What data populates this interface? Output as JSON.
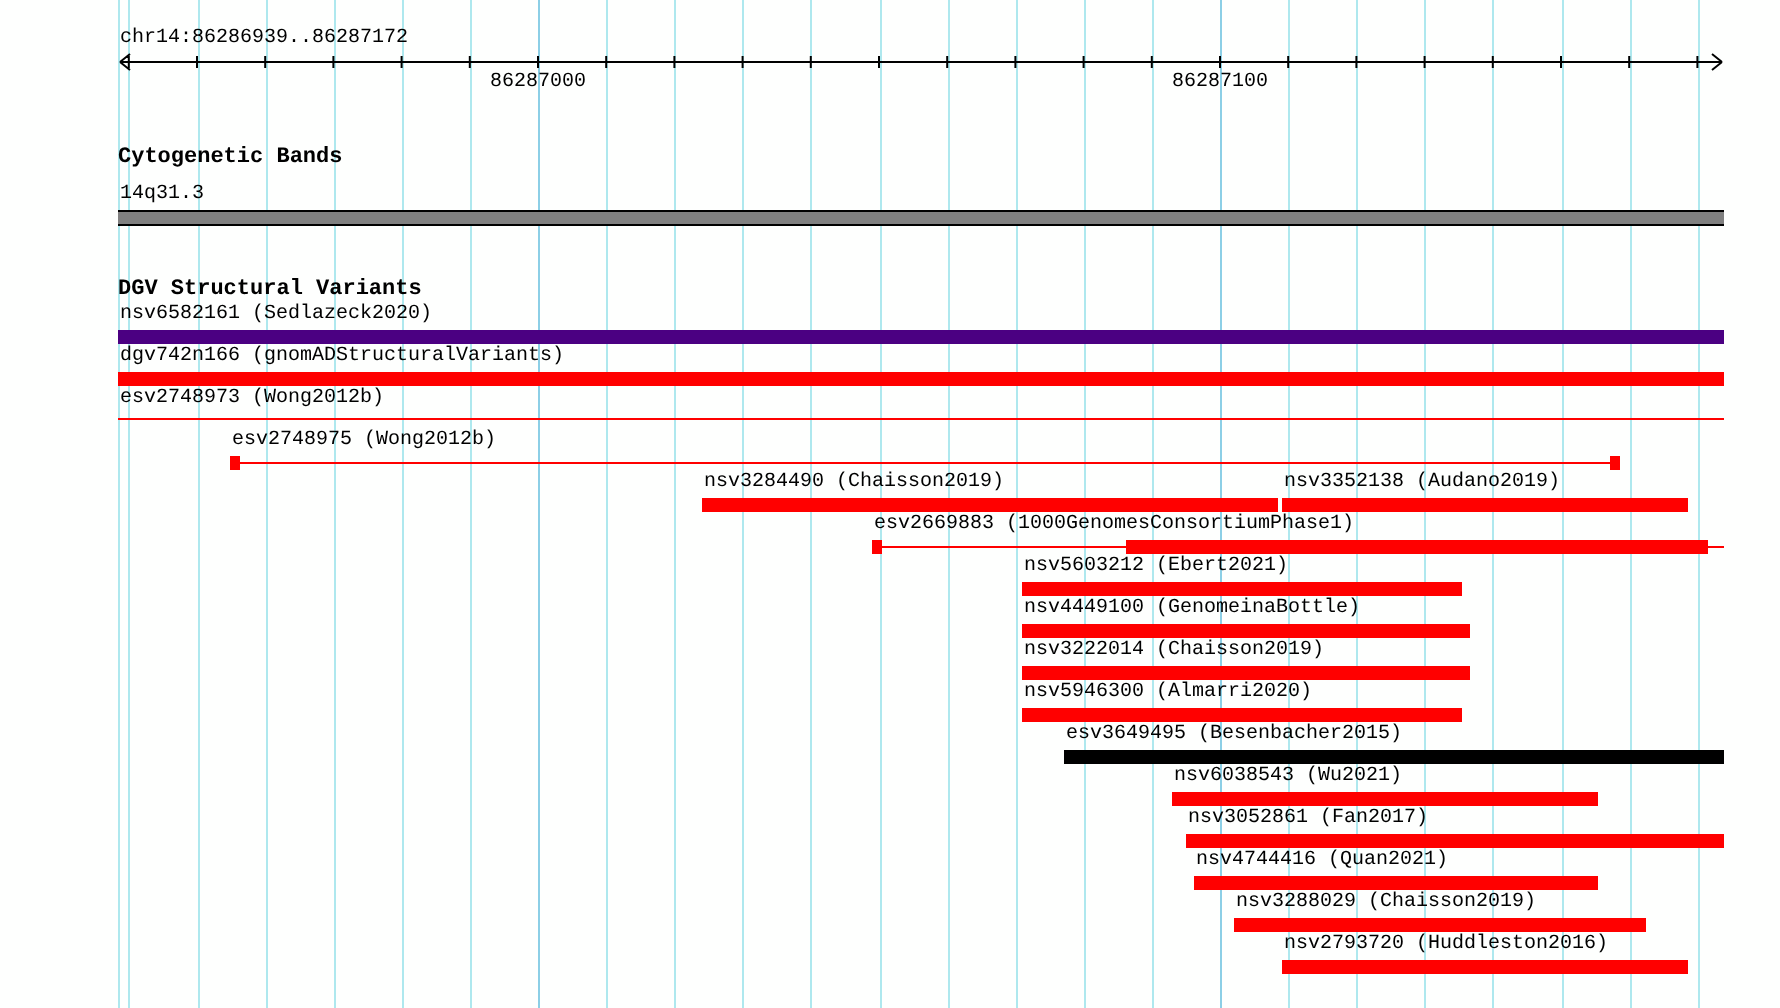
{
  "ruler": {
    "location": "chr14:86286939..86287172",
    "tick_labels": [
      "86287000",
      "86287100"
    ]
  },
  "cytogenetic_bands": {
    "title": "Cytogenetic Bands",
    "band": {
      "label": "14q31.3"
    }
  },
  "dgv_track": {
    "title": "DGV Structural Variants",
    "rows": [
      [
        {
          "label": "nsv6582161 (Sedlazeck2020)",
          "kind": "bar",
          "color": "#4b0082"
        }
      ],
      [
        {
          "label": "dgv742n166 (gnomADStructuralVariants)",
          "kind": "bar",
          "color": "#ff0000"
        }
      ],
      [
        {
          "label": "esv2748973 (Wong2012b)",
          "kind": "line",
          "color": "#ff0000"
        }
      ],
      [
        {
          "label": "esv2748975 (Wong2012b)",
          "kind": "capped_line",
          "color": "#ff0000"
        }
      ],
      [
        {
          "label": "nsv3284490 (Chaisson2019)",
          "kind": "bar",
          "color": "#ff0000"
        },
        {
          "label": "nsv3352138 (Audano2019)",
          "kind": "bar",
          "color": "#ff0000"
        }
      ],
      [
        {
          "label": "esv2669883 (1000GenomesConsortiumPhase1)",
          "kind": "line_with_block",
          "color": "#ff0000"
        }
      ],
      [
        {
          "label": "nsv5603212 (Ebert2021)",
          "kind": "bar",
          "color": "#ff0000"
        }
      ],
      [
        {
          "label": "nsv4449100 (GenomeinaBottle)",
          "kind": "bar",
          "color": "#ff0000"
        }
      ],
      [
        {
          "label": "nsv3222014 (Chaisson2019)",
          "kind": "bar",
          "color": "#ff0000"
        }
      ],
      [
        {
          "label": "nsv5946300 (Almarri2020)",
          "kind": "bar",
          "color": "#ff0000"
        }
      ],
      [
        {
          "label": "esv3649495 (Besenbacher2015)",
          "kind": "bar",
          "color": "#000000"
        }
      ],
      [
        {
          "label": "nsv6038543 (Wu2021)",
          "kind": "bar",
          "color": "#ff0000"
        }
      ],
      [
        {
          "label": "nsv3052861 (Fan2017)",
          "kind": "bar",
          "color": "#ff0000"
        }
      ],
      [
        {
          "label": "nsv4744416 (Quan2021)",
          "kind": "bar",
          "color": "#ff0000"
        }
      ],
      [
        {
          "label": "nsv3288029 (Chaisson2019)",
          "kind": "bar",
          "color": "#ff0000"
        }
      ],
      [
        {
          "label": "nsv2793720 (Huddleston2016)",
          "kind": "bar",
          "color": "#ff0000"
        }
      ]
    ]
  }
}
